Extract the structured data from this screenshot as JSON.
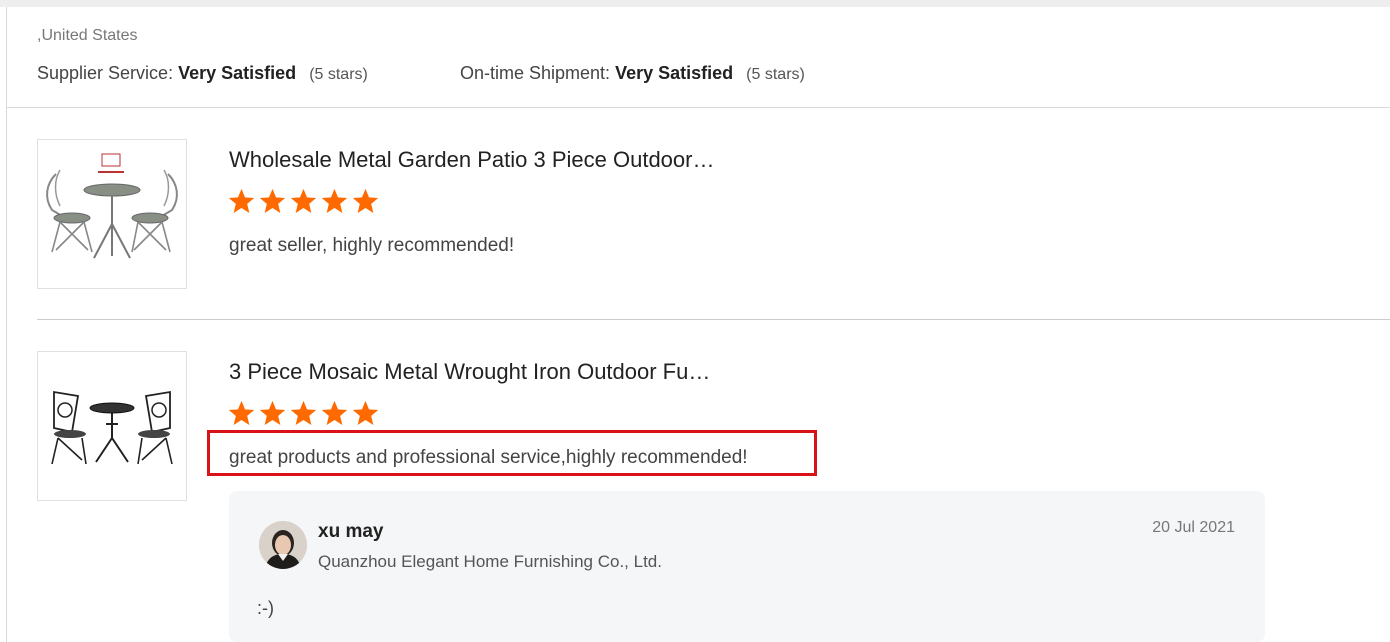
{
  "header": {
    "location": ",United States",
    "supplier_service": {
      "label": "Supplier Service:",
      "value": "Very Satisfied",
      "note": "(5 stars)"
    },
    "ontime_shipment": {
      "label": "On-time Shipment:",
      "value": "Very Satisfied",
      "note": "(5 stars)"
    }
  },
  "reviews": [
    {
      "product_title": "Wholesale Metal Garden Patio 3 Piece Outdoor…",
      "rating": 5,
      "comment": "great seller, highly recommended!",
      "thumb_icon": "patio-set-image"
    },
    {
      "product_title": "3 Piece Mosaic Metal Wrought Iron Outdoor Fu…",
      "rating": 5,
      "comment": "great products and professional service,highly recommended!",
      "thumb_icon": "wrought-iron-set-image",
      "reply": {
        "name": "xu may",
        "company": "Quanzhou Elegant Home Furnishing Co., Ltd.",
        "date": "20 Jul 2021",
        "text": ":-)"
      }
    }
  ],
  "colors": {
    "star": "#ff6a00",
    "highlight": "#d9121a",
    "reply_bg": "#f5f6f8"
  }
}
